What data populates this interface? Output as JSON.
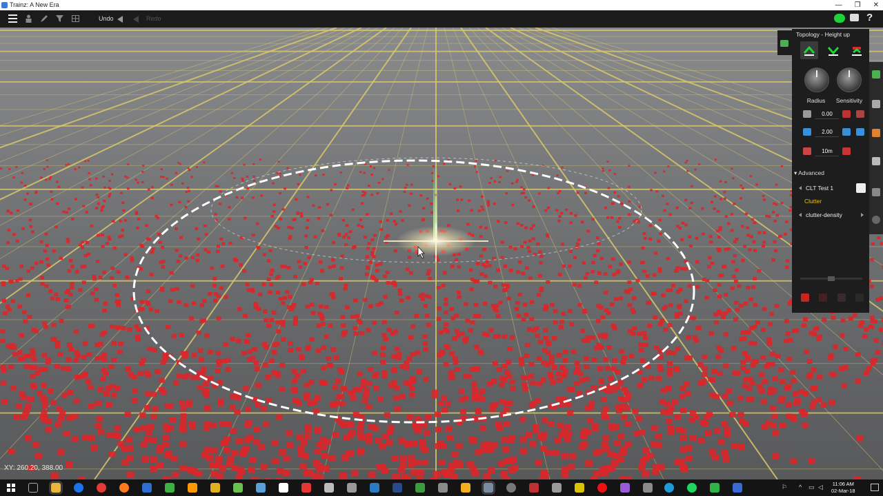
{
  "window": {
    "title": "Trainz: A New Era",
    "min_glyph": "—",
    "max_glyph": "❐",
    "close_glyph": "✕"
  },
  "toolbar": {
    "undo_label": "Undo",
    "redo_label": "Redo"
  },
  "viewport": {
    "coords_label": "XY: 260.20, 388.00"
  },
  "panel": {
    "header": "Topology - Height up",
    "radius_label": "Radius",
    "sensitivity_label": "Sensitivity",
    "value_1": "0.00",
    "value_2": "2.00",
    "value_3": "10m",
    "advanced_label": "Advanced",
    "asset_select": "CLT Test 1",
    "clutter_label": "Clutter",
    "density_select": "clutter-density"
  },
  "taskbar": {
    "time": "11:06 AM",
    "date": "02-Mar-18"
  },
  "colors": {
    "accent_green": "#1ed23a",
    "clutter_red": "#d9272b",
    "grid_yellow": "#d8c86a"
  }
}
